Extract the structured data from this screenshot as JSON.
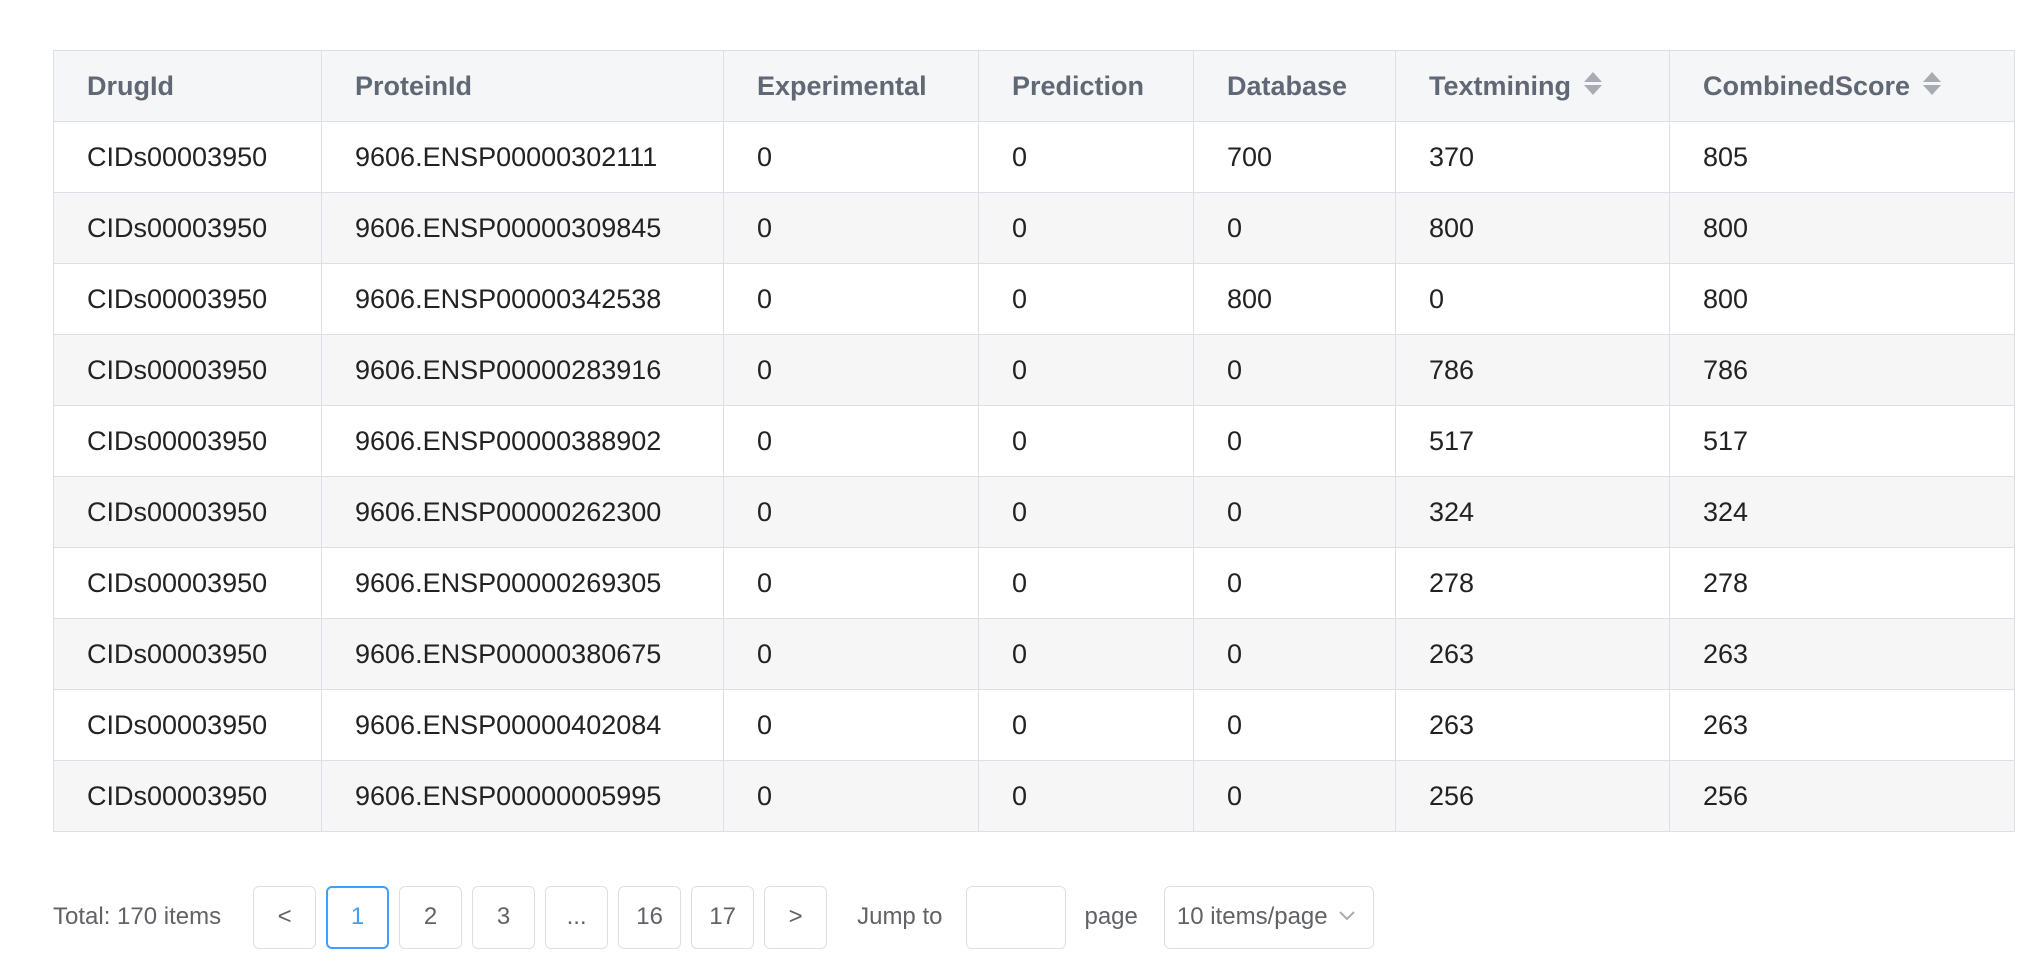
{
  "table": {
    "columns": [
      {
        "label": "DrugId",
        "sortable": false
      },
      {
        "label": "ProteinId",
        "sortable": false
      },
      {
        "label": "Experimental",
        "sortable": false
      },
      {
        "label": "Prediction",
        "sortable": false
      },
      {
        "label": "Database",
        "sortable": false
      },
      {
        "label": "Textmining",
        "sortable": true
      },
      {
        "label": "CombinedScore",
        "sortable": true
      }
    ],
    "rows": [
      [
        "CIDs00003950",
        "9606.ENSP00000302111",
        "0",
        "0",
        "700",
        "370",
        "805"
      ],
      [
        "CIDs00003950",
        "9606.ENSP00000309845",
        "0",
        "0",
        "0",
        "800",
        "800"
      ],
      [
        "CIDs00003950",
        "9606.ENSP00000342538",
        "0",
        "0",
        "800",
        "0",
        "800"
      ],
      [
        "CIDs00003950",
        "9606.ENSP00000283916",
        "0",
        "0",
        "0",
        "786",
        "786"
      ],
      [
        "CIDs00003950",
        "9606.ENSP00000388902",
        "0",
        "0",
        "0",
        "517",
        "517"
      ],
      [
        "CIDs00003950",
        "9606.ENSP00000262300",
        "0",
        "0",
        "0",
        "324",
        "324"
      ],
      [
        "CIDs00003950",
        "9606.ENSP00000269305",
        "0",
        "0",
        "0",
        "278",
        "278"
      ],
      [
        "CIDs00003950",
        "9606.ENSP00000380675",
        "0",
        "0",
        "0",
        "263",
        "263"
      ],
      [
        "CIDs00003950",
        "9606.ENSP00000402084",
        "0",
        "0",
        "0",
        "263",
        "263"
      ],
      [
        "CIDs00003950",
        "9606.ENSP00000005995",
        "0",
        "0",
        "0",
        "256",
        "256"
      ]
    ]
  },
  "pagination": {
    "total_label": "Total: 170 items",
    "prev_label": "<",
    "next_label": ">",
    "pages": [
      "1",
      "2",
      "3",
      "...",
      "16",
      "17"
    ],
    "active_page": "1",
    "jump_label": "Jump to",
    "jump_value": "",
    "page_label": "page",
    "page_size_label": "10 items/page"
  },
  "colors": {
    "accent": "#409eff",
    "border": "#dcdfe6",
    "header_bg": "#f5f6f7",
    "stripe_bg": "#f6f6f6"
  },
  "icons": {
    "sort": "sort-icon",
    "page_size_chevron": "chevron-down-icon"
  }
}
